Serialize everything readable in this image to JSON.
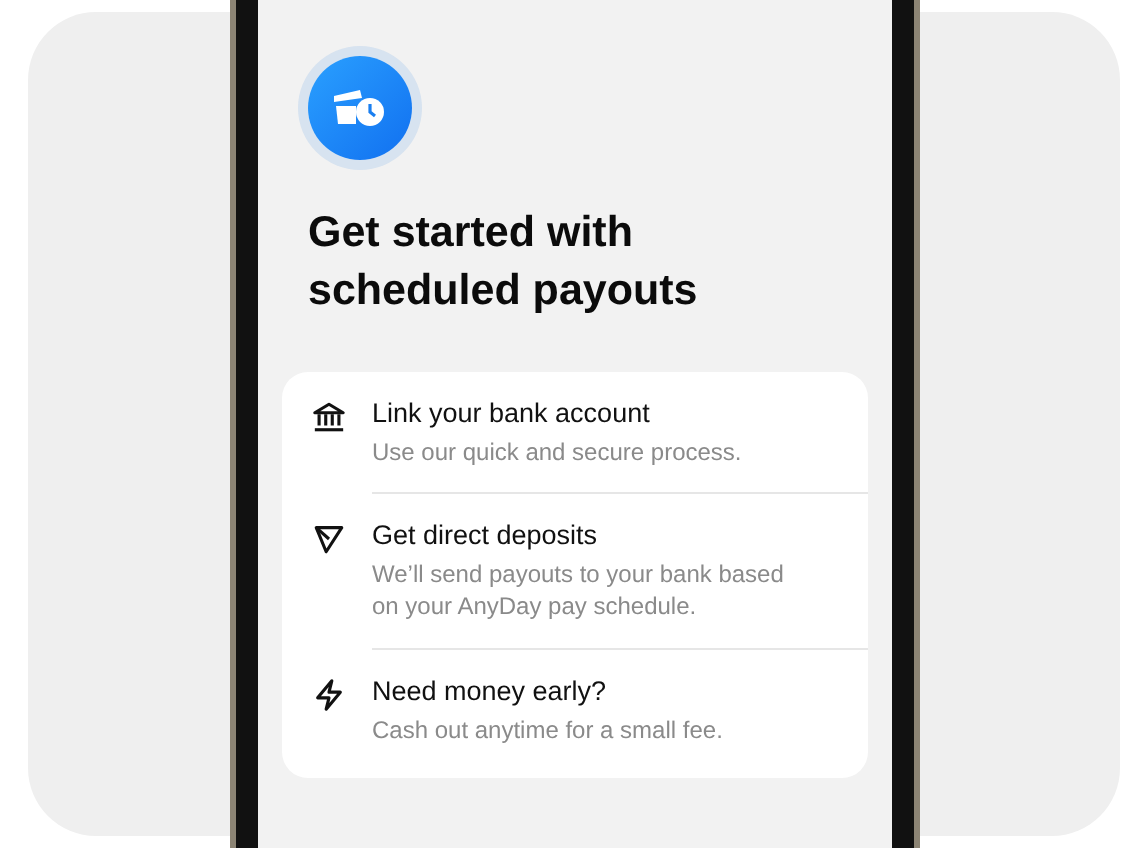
{
  "title": "Get started with scheduled payouts",
  "steps": [
    {
      "title": "Link your bank account",
      "description": "Use our quick and secure process."
    },
    {
      "title": "Get direct deposits",
      "description": "We’ll send payouts to your bank based on your AnyDay pay schedule."
    },
    {
      "title": "Need money early?",
      "description": "Cash out anytime for a small fee."
    }
  ]
}
